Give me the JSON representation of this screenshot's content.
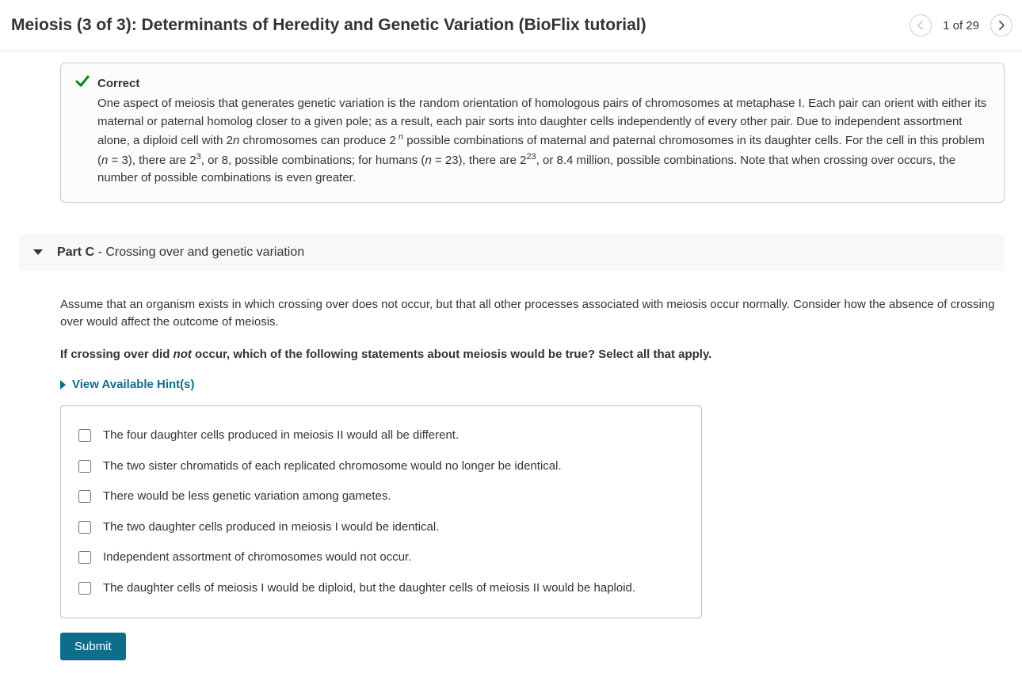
{
  "header": {
    "title": "Meiosis (3 of 3): Determinants of Heredity and Genetic Variation (BioFlix tutorial)",
    "nav_count": "1 of 29"
  },
  "feedback": {
    "status": "Correct",
    "text_pre": "One aspect of meiosis that generates genetic variation is the random orientation of homologous pairs of chromosomes at metaphase I. Each pair can orient with either its maternal or paternal homolog closer to a given pole; as a result, each pair sorts into daughter cells independently of every other pair. Due to independent assortment alone, a diploid cell with 2",
    "n1": "n",
    "text_mid1": " chromosomes can produce 2",
    "sup1": " n",
    "text_mid2": " possible combinations of maternal and paternal chromosomes in its daughter cells. For the cell in this problem (",
    "n_eq_3": "n",
    "eq3": " = 3), there are 2",
    "sup3": "3",
    "text_mid3": ", or 8, possible combinations; for humans (",
    "n_eq_23": "n",
    "eq23": " = 23), there are 2",
    "sup23": "23",
    "text_post": ", or 8.4 million, possible combinations. Note that when crossing over occurs, the number of possible combinations is even greater."
  },
  "partC": {
    "label": "Part C",
    "separator": " - ",
    "subtitle": "Crossing over and genetic variation",
    "intro": "Assume that an organism exists in which crossing over does not occur, but that all other processes associated with meiosis occur normally. Consider how the absence of crossing over would affect the outcome of meiosis.",
    "question_pre": "If crossing over did ",
    "question_not": "not",
    "question_post": " occur, which of the following statements about meiosis would be true? Select all that apply.",
    "hints_label": "View Available Hint(s)",
    "options": [
      "The four daughter cells produced in meiosis II would all be different.",
      "The two sister chromatids of each replicated chromosome would no longer be identical.",
      "There would be less genetic variation among gametes.",
      "The two daughter cells produced in meiosis I would be identical.",
      "Independent assortment of chromosomes would not occur.",
      "The daughter cells of meiosis I would be diploid, but the daughter cells of meiosis II would be haploid."
    ],
    "submit": "Submit"
  }
}
